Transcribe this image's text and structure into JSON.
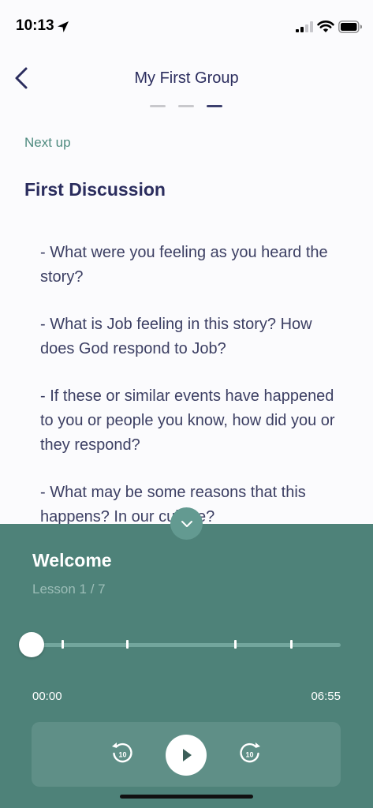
{
  "status_bar": {
    "time": "10:13",
    "icons": [
      "location-arrow-icon",
      "cellular-signal-icon",
      "wifi-icon",
      "battery-icon"
    ]
  },
  "header": {
    "title": "My First Group",
    "steps": {
      "count": 3,
      "active_index": 2
    }
  },
  "content": {
    "next_up_label": "Next up",
    "section_title": "First Discussion",
    "questions": [
      "- What were you feeling as you heard the story?",
      "- What is Job feeling in this story? How does God respond to Job?",
      "- If these or similar events have happened to you or people you know, how did you or they respond?",
      "- What may be some reasons that this happens? In our culture?"
    ]
  },
  "player": {
    "title": "Welcome",
    "subtitle": "Lesson 1 / 7",
    "current_time": "00:00",
    "total_time": "06:55",
    "progress_fraction": 0,
    "marker_fractions": [
      0.1,
      0.31,
      0.66,
      0.84
    ],
    "controls": {
      "rewind_seconds": "10",
      "forward_seconds": "10"
    }
  },
  "colors": {
    "text_primary": "#2b2d5e",
    "accent": "#4e8a7f",
    "player_bg": "#4e8279"
  }
}
